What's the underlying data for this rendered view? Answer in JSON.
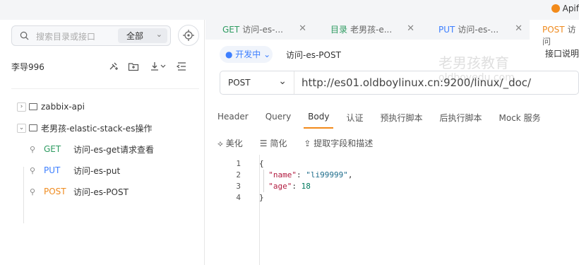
{
  "brand": {
    "label": "Apif"
  },
  "sidebar": {
    "search_placeholder": "搜索目录或接口",
    "scope_label": "全部",
    "project_name": "李导996",
    "tree": [
      {
        "type": "folder",
        "label": "zabbix-api",
        "expanded": false
      },
      {
        "type": "folder",
        "label": "老男孩-elastic-stack-es操作",
        "expanded": true
      }
    ],
    "endpoints": [
      {
        "method": "GET",
        "label": "访问-es-get请求查看"
      },
      {
        "method": "PUT",
        "label": "访问-es-put"
      },
      {
        "method": "POST",
        "label": "访问-es-POST"
      }
    ]
  },
  "tabs": [
    {
      "method": "GET",
      "label": "访问-es-..."
    },
    {
      "method": "目录",
      "label": "老男孩-e..."
    },
    {
      "method": "PUT",
      "label": "访问-es-..."
    },
    {
      "method": "POST",
      "label": "访问"
    }
  ],
  "request": {
    "env_label": "● 开发中 ⌄",
    "name": "访问-es-POST",
    "interface_desc": "接口说明",
    "method": "POST",
    "url": "http://es01.oldboylinux.cn:9200/linux/_doc/"
  },
  "req_tabs": [
    "Header",
    "Query",
    "Body",
    "认证",
    "预执行脚本",
    "后执行脚本",
    "Mock 服务"
  ],
  "active_req_tab": "Body",
  "body_tools": [
    "⟡ 美化",
    "☰ 简化",
    "⇪ 提取字段和描述"
  ],
  "editor": {
    "line_numbers": [
      "1",
      "2",
      "3",
      "4"
    ],
    "lines": [
      [
        "{"
      ],
      [
        "\"name\"",
        ": ",
        "\"li99999\"",
        ","
      ],
      [
        "\"age\"",
        ": ",
        "18"
      ],
      [
        "}"
      ]
    ]
  },
  "watermark": {
    "title": "老男孩教育",
    "sub": "oldboyedu.com"
  }
}
